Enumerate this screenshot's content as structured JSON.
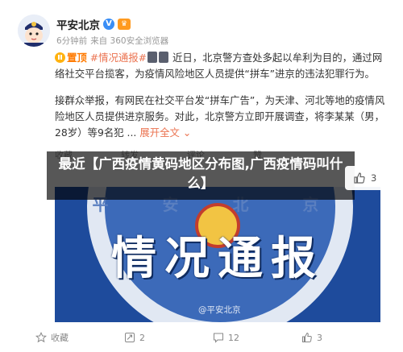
{
  "header": {
    "name": "平安北京",
    "badge_v": "V",
    "time": "6分钟前",
    "source": "来自 360安全浏览器"
  },
  "post": {
    "pin_label": "置顶",
    "hashtag": "#情况通报#",
    "para1_rest": "近日，北京警方查处多起以牟利为目的，通过网络社交平台揽客，为疫情风险地区人员提供“拼车”进京的违法犯罪行为。",
    "para2": "接群众举报，有网民在社交平台发“拼车广告”，为天津、河北等地的疫情风险地区人员提供进京服务。对此，北京警方立即开展调查，将李某某（男，28岁）等9名犯 ...",
    "expand": "展开全文",
    "expand_icon": "chevron-down-icon"
  },
  "actions_top": [
    "收藏",
    "转发",
    "评论",
    "赞"
  ],
  "overlay": {
    "title": "最近【广西疫情黄码地区分布图,广西疫情码叫什么】"
  },
  "like_box": {
    "count": "3"
  },
  "poster": {
    "arc_text": "平 安 北 京",
    "main_text": "情况通报",
    "watermark": "@平安北京"
  },
  "actions_bottom": {
    "favorite": "收藏",
    "repost": "2",
    "comment": "12",
    "like": "3"
  },
  "colors": {
    "accent": "#eb7350",
    "pin": "#ff7a00",
    "poster_bg": "#1e4b9c"
  }
}
